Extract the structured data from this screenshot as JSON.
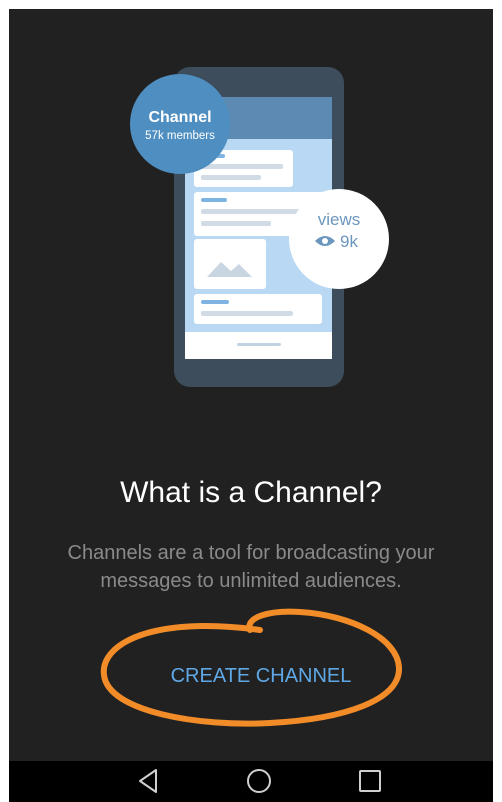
{
  "illustration": {
    "channel_badge": {
      "title": "Channel",
      "subtitle": "57k members"
    },
    "views_badge": {
      "label": "views",
      "count": "9k",
      "icon": "eye-icon"
    },
    "image_placeholder_icon": "mountain-image-icon"
  },
  "intro": {
    "title": "What is a Channel?",
    "description": "Channels are a tool for broadcasting your messages to unlimited audiences."
  },
  "actions": {
    "create_label": "CREATE CHANNEL"
  },
  "nav_bar": {
    "back_icon": "back-triangle-icon",
    "home_icon": "home-circle-icon",
    "recents_icon": "recents-square-icon"
  },
  "colors": {
    "background": "#212121",
    "accent": "#5fa8e6",
    "badge": "#4f8ec0",
    "phone_frame": "#3d4d5b",
    "annotation": "#f28c28"
  }
}
